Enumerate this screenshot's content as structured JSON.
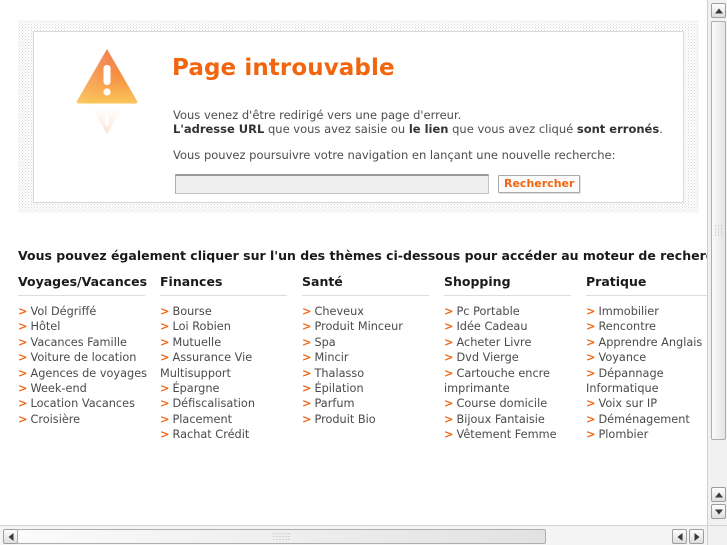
{
  "error_panel": {
    "icon": "warning-triangle-icon",
    "title": "Page introuvable",
    "line1": "Vous venez d'être redirigé vers une page d'erreur.",
    "line2_parts": {
      "bold1": "L'adresse URL",
      "text1": " que vous avez saisie ou ",
      "bold2": "le lien",
      "text2": " que vous avez cliqué ",
      "bold3": "sont erronés",
      "text3": "."
    },
    "line3": "Vous pouvez poursuivre votre navigation en lançant une nouvelle recherche:",
    "search": {
      "value": "",
      "placeholder": "",
      "button_label": "Rechercher"
    }
  },
  "themes": {
    "heading": "Vous pouvez également cliquer sur l'un des thèmes ci-dessous pour accéder au moteur de recherche :",
    "bullet": ">",
    "columns": [
      {
        "title": "Voyages/Vacances",
        "items": [
          "Vol Dégriffé",
          "Hôtel",
          "Vacances Famille",
          "Voiture de location",
          "Agences de voyages",
          "Week-end",
          "Location Vacances",
          "Croisière"
        ]
      },
      {
        "title": "Finances",
        "items": [
          "Bourse",
          "Loi Robien",
          "Mutuelle",
          "Assurance Vie Multisupport",
          "Épargne",
          "Défiscalisation",
          "Placement",
          "Rachat Crédit"
        ]
      },
      {
        "title": "Santé",
        "items": [
          "Cheveux",
          "Produit Minceur",
          "Spa",
          "Mincir",
          "Thalasso",
          "Épilation",
          "Parfum",
          "Produit Bio"
        ]
      },
      {
        "title": "Shopping",
        "items": [
          "Pc Portable",
          "Idée Cadeau",
          "Acheter Livre",
          "Dvd Vierge",
          "Cartouche encre imprimante",
          "Course domicile",
          "Bijoux Fantaisie",
          "Vêtement Femme"
        ]
      },
      {
        "title": "Pratique",
        "items": [
          "Immobilier",
          "Rencontre",
          "Apprendre Anglais",
          "Voyance",
          "Dépannage Informatique",
          "Voix sur IP",
          "Déménagement",
          "Plombier"
        ]
      }
    ]
  },
  "colors": {
    "accent_orange": "#f2650f",
    "heading_dark": "#1a1a1a",
    "body_gray": "#4a4a4a",
    "rule_gray": "#dddddd"
  },
  "scrollbars": {
    "vertical": {
      "up_icon": "triangle-up-icon",
      "down_icon": "triangle-down-icon"
    },
    "horizontal": {
      "left_icon": "triangle-left-icon",
      "right_icon": "triangle-right-icon"
    }
  }
}
